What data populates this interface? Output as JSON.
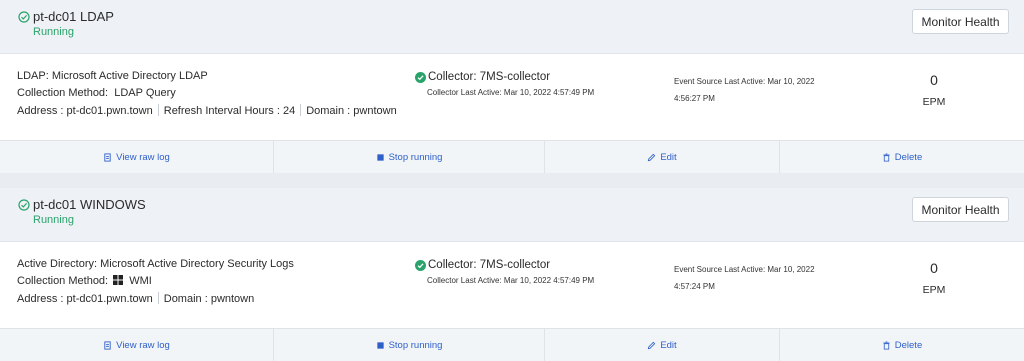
{
  "cards": [
    {
      "title": "pt-dc01 LDAP",
      "state": "Running",
      "monitor_label": "Monitor Health",
      "source_line": "LDAP: Microsoft Active Directory LDAP",
      "method_prefix": "Collection Method:",
      "method_value": "LDAP Query",
      "address": "Address : pt-dc01.pwn.town",
      "refresh": "Refresh Interval Hours : 24",
      "domain": "Domain : pwntown",
      "collector": "Collector: 7MS-collector",
      "collector_last": "Collector Last Active: Mar 10, 2022 4:57:49 PM",
      "event_source_label": "Event Source Last Active: Mar 10, 2022",
      "event_source_time": "4:56:27 PM",
      "epm_value": "0",
      "epm_label": "EPM"
    },
    {
      "title": "pt-dc01 WINDOWS",
      "state": "Running",
      "monitor_label": "Monitor Health",
      "source_line": "Active Directory: Microsoft Active Directory Security Logs",
      "method_prefix": "Collection Method:",
      "method_value": "WMI",
      "address": "Address : pt-dc01.pwn.town",
      "domain": "Domain : pwntown",
      "collector": "Collector: 7MS-collector",
      "collector_last": "Collector Last Active: Mar 10, 2022 4:57:49 PM",
      "event_source_label": "Event Source Last Active: Mar 10, 2022",
      "event_source_time": "4:57:24 PM",
      "epm_value": "0",
      "epm_label": "EPM"
    }
  ],
  "actions": {
    "view_raw_log": "View raw log",
    "stop_running": "Stop running",
    "edit": "Edit",
    "delete": "Delete"
  },
  "colors": {
    "running": "#2aa36b",
    "action_link": "#2f5fc9",
    "header_bg": "#eef1f5"
  }
}
